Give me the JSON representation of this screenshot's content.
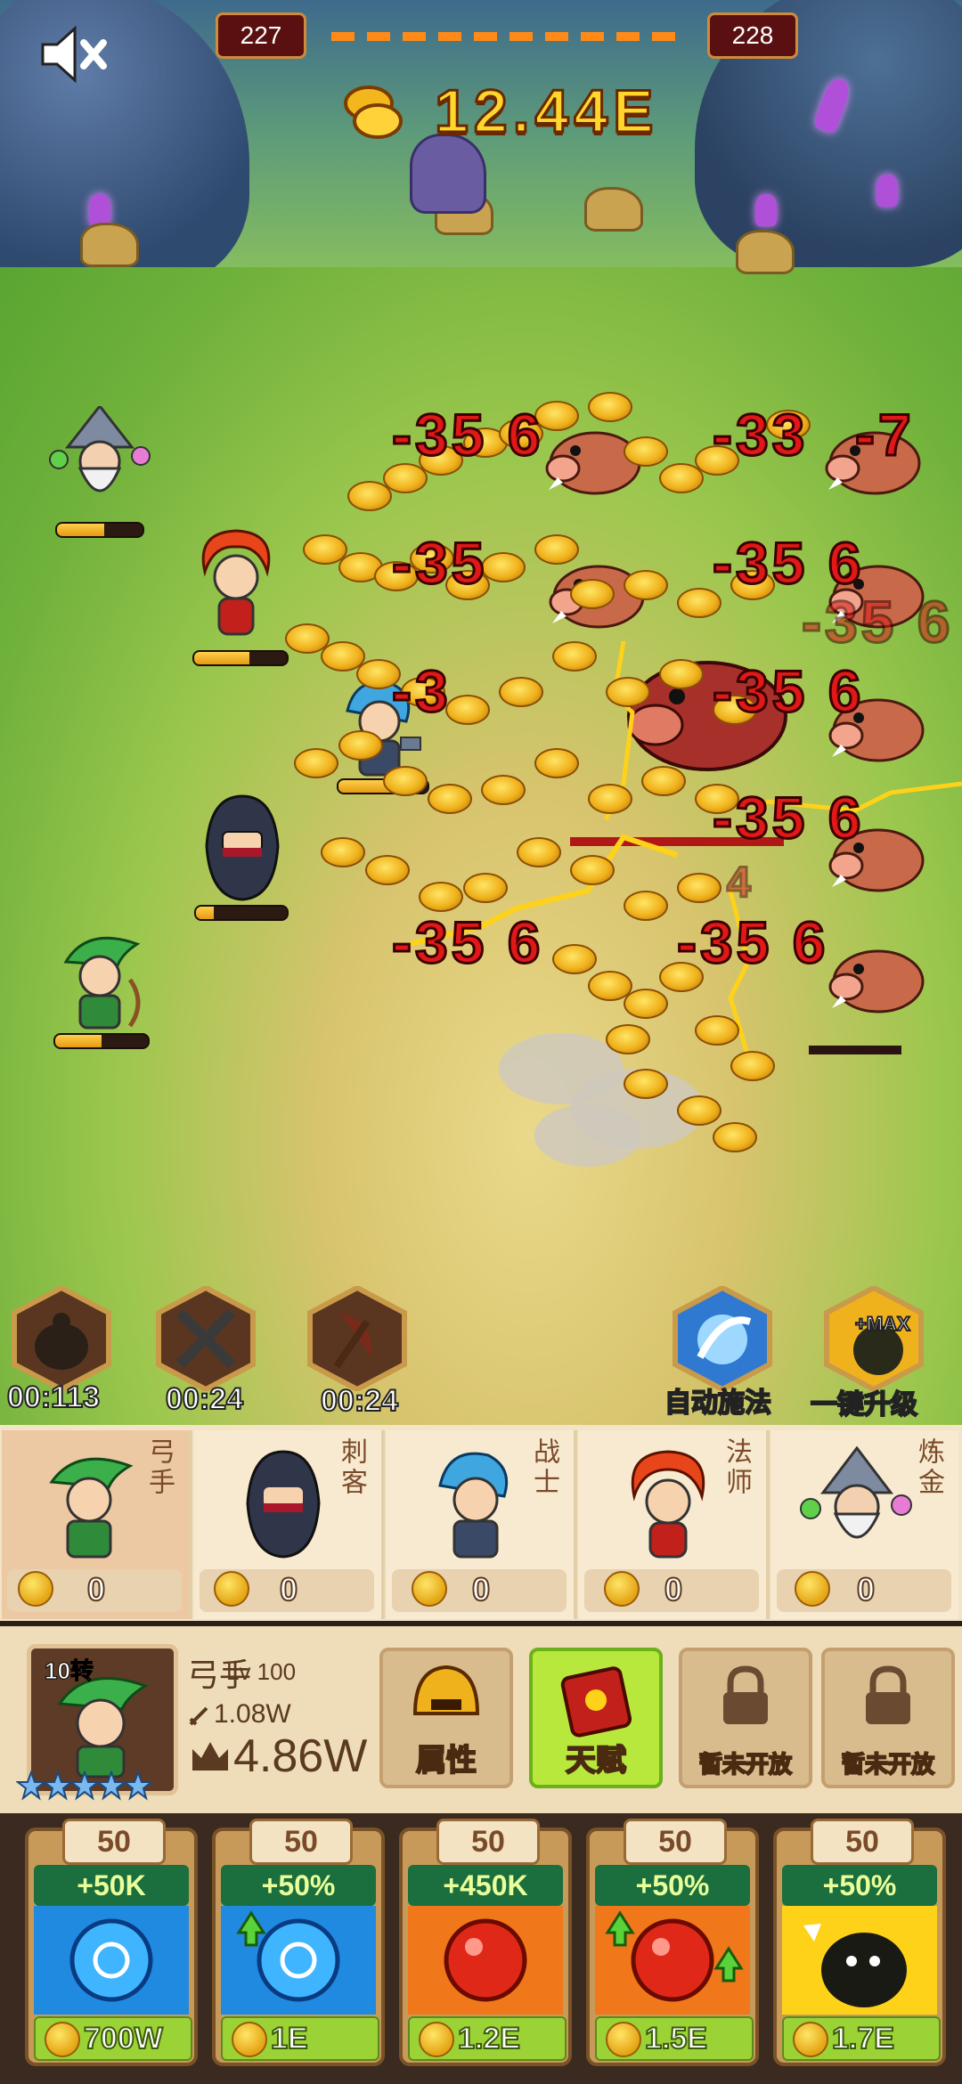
{
  "hud": {
    "current_level": "227",
    "next_level": "228",
    "gold": "12.44E",
    "sound_icon": "speaker-muted-icon"
  },
  "battle": {
    "damage_numbers": [
      "-35 6",
      "-33",
      "-7",
      "-35",
      "-35 6",
      "-35 6",
      "-3",
      "-35 6",
      "-35 6",
      "-35 6",
      "-35 6",
      "4"
    ],
    "colors": {
      "damage": "#e01818",
      "coin": "#f0b21c",
      "hp_fill": "#f0a61c"
    }
  },
  "skills": [
    {
      "icon": "money-bag-icon",
      "timer": "00:113"
    },
    {
      "icon": "crossed-swords-icon",
      "timer": "00:24"
    },
    {
      "icon": "red-axe-icon",
      "timer": "00:24"
    },
    {
      "icon": "auto-cast-icon",
      "label": "自动施法"
    },
    {
      "icon": "max-upgrade-icon",
      "label": "一键升级",
      "badge": "+MAX"
    }
  ],
  "hero_tabs": [
    {
      "name": "弓手",
      "count": "0"
    },
    {
      "name": "刺客",
      "count": "0"
    },
    {
      "name": "战士",
      "count": "0"
    },
    {
      "name": "法师",
      "count": "0"
    },
    {
      "name": "炼金",
      "count": "0"
    }
  ],
  "detail": {
    "rebirth": "10转",
    "name": "弓手",
    "level": "Lv 100",
    "dps": "1.08W",
    "power": "4.86W",
    "stars": 5,
    "buttons": [
      "属性",
      "天赋",
      "暂未开放",
      "暂未开放"
    ]
  },
  "upgrades": [
    {
      "level": "50",
      "bonus": "+50K",
      "price": "700W",
      "icon": "blue-orb-icon"
    },
    {
      "level": "50",
      "bonus": "+50%",
      "price": "1E",
      "icon": "blue-orb-arrow-icon"
    },
    {
      "level": "50",
      "bonus": "+450K",
      "price": "1.2E",
      "icon": "red-orb-icon"
    },
    {
      "level": "50",
      "bonus": "+50%",
      "price": "1.5E",
      "icon": "red-orb-arrow-icon"
    },
    {
      "level": "50",
      "bonus": "+50%",
      "price": "1.7E",
      "icon": "black-blob-icon"
    }
  ]
}
